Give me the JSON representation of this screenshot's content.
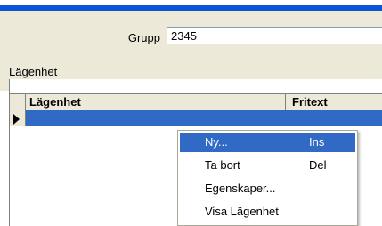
{
  "form": {
    "grupp_label": "Grupp",
    "grupp_value": "2345",
    "section_label": "Lägenhet"
  },
  "grid": {
    "columns": [
      "Lägenhet",
      "Fritext"
    ]
  },
  "context_menu": {
    "items": [
      {
        "label": "Ny...",
        "shortcut": "Ins"
      },
      {
        "label": "Ta bort",
        "shortcut": "Del"
      },
      {
        "label": "Egenskaper...",
        "shortcut": ""
      },
      {
        "label": "Visa Lägenhet",
        "shortcut": ""
      }
    ]
  },
  "colors": {
    "title_bar": "#0a55d4",
    "selection": "#316ac5",
    "face": "#ece9d8"
  }
}
